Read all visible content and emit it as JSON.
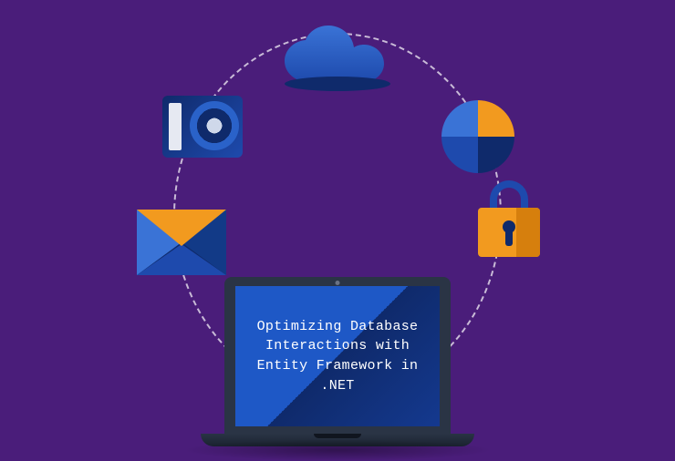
{
  "laptop": {
    "screen_text": "Optimizing Database Interactions with Entity Framework in .NET"
  },
  "icons": {
    "cloud": "cloud-icon",
    "camera": "storage-disc-icon",
    "envelope": "envelope-icon",
    "pie": "pie-chart-icon",
    "lock": "lock-icon"
  },
  "colors": {
    "background": "#4a1d7a",
    "primary_blue": "#1e4aad",
    "dark_blue": "#0f2a6b",
    "light_blue": "#3a73d6",
    "orange": "#f29a1f"
  }
}
